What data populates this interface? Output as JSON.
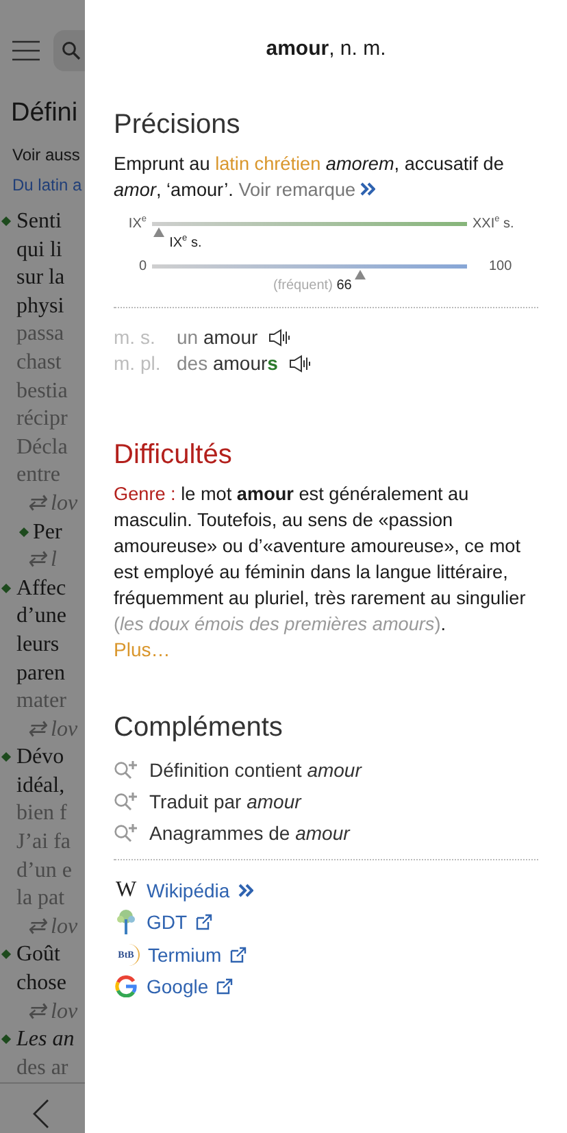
{
  "background_page": {
    "title": "Défini",
    "see_also": "Voir auss",
    "etymology": "Du latin a",
    "lines": [
      {
        "kind": "bullet",
        "text": "Senti"
      },
      {
        "kind": "line",
        "text": "qui li"
      },
      {
        "kind": "line",
        "text": "sur la"
      },
      {
        "kind": "line",
        "text": "physi"
      },
      {
        "kind": "faded",
        "text": "passa"
      },
      {
        "kind": "faded",
        "text": "chast"
      },
      {
        "kind": "faded",
        "text": "bestia"
      },
      {
        "kind": "faded",
        "text": "récipr"
      },
      {
        "kind": "faded",
        "text": "Décla"
      },
      {
        "kind": "faded",
        "text": "entre"
      },
      {
        "kind": "translation",
        "text": "⇄ lov"
      },
      {
        "kind": "subbullet",
        "text": "Per"
      },
      {
        "kind": "translation",
        "text": "⇄ l"
      },
      {
        "kind": "bullet",
        "text": "Affec"
      },
      {
        "kind": "line",
        "text": "d’une"
      },
      {
        "kind": "line",
        "text": "leurs"
      },
      {
        "kind": "line",
        "text": "paren"
      },
      {
        "kind": "faded",
        "text": "mater"
      },
      {
        "kind": "translation",
        "text": "⇄ lov"
      },
      {
        "kind": "bullet",
        "text": "Dévo"
      },
      {
        "kind": "line",
        "text": "idéal,"
      },
      {
        "kind": "faded",
        "text": "bien f"
      },
      {
        "kind": "faded",
        "text": "J’ai fa"
      },
      {
        "kind": "faded",
        "text": "d’un e"
      },
      {
        "kind": "faded",
        "text": "la pat"
      },
      {
        "kind": "translation",
        "text": "⇄ lov"
      },
      {
        "kind": "bullet",
        "text": "Goût"
      },
      {
        "kind": "line",
        "text": "chose"
      },
      {
        "kind": "translation",
        "text": "⇄ lov"
      },
      {
        "kind": "italic_bullet",
        "text": "Les an"
      },
      {
        "kind": "faded",
        "text": "des ar"
      }
    ]
  },
  "panel": {
    "headword": "amour",
    "grammar": ", n. m.",
    "precisions": {
      "title": "Précisions",
      "before": "Emprunt au ",
      "link": "latin chrétien",
      "after": " *amorem*, accusatif de *amor*, ‘amour’.",
      "more": "Voir remarque",
      "timeline": {
        "start": "IX$^{e}$",
        "end": "XXI$^{e}$ s.",
        "marker": "IX$^{e}$ s.",
        "level": 0.02
      },
      "frequency": {
        "start": "0",
        "end": "100",
        "caption": "(fréquent)",
        "value": "66",
        "level": 0.66
      },
      "forms": [
        {
          "label": "m. s.",
          "article": "un",
          "word": "amour"
        },
        {
          "label": "m. pl.",
          "article": "des",
          "word": "amour",
          "ending": "s"
        }
      ]
    },
    "difficulties": {
      "title": "Difficultés",
      "label": "Genre :",
      "text": "le mot **amour** est généralement au masculin. Toutefois, au sens de «passion amoureuse» ou d’«aventure amoureuse», ce mot est employé au féminin dans la langue littéraire, fréquemment au pluriel, très rarement au singulier ",
      "example": "(*les doux émois des premières amours*)",
      "tail": ".",
      "more": "Plus…"
    },
    "complements": {
      "title": "Compléments",
      "searches": [
        "Définition contient *amour*",
        "Traduit par *amour*",
        "Anagrammes de *amour*"
      ],
      "links": [
        {
          "kind": "wikipedia",
          "logo": "W",
          "label": "Wikipédia",
          "external": false
        },
        {
          "kind": "gdt",
          "label": "GDT",
          "external": true
        },
        {
          "kind": "termium",
          "logo": "BtB",
          "label": "Termium",
          "external": true
        },
        {
          "kind": "google",
          "label": "Google",
          "external": true
        }
      ]
    }
  }
}
